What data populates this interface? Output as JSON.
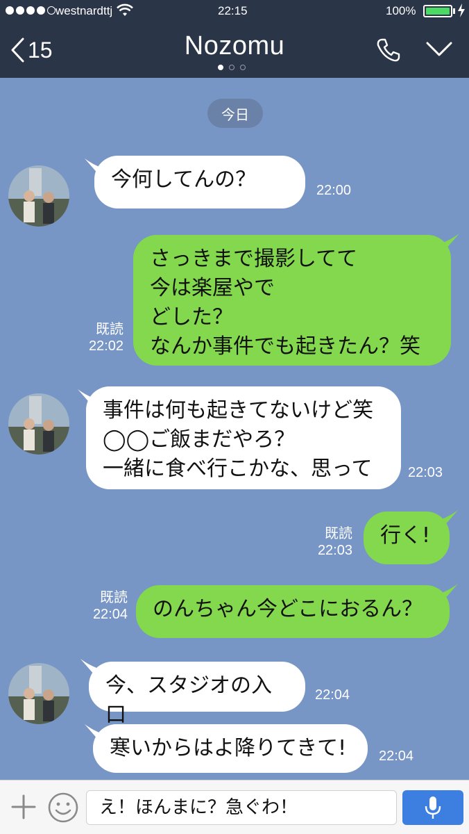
{
  "status_bar": {
    "carrier": "westnardttj",
    "time": "22:15",
    "battery": "100%",
    "battery_level": 1.0
  },
  "header": {
    "back_count": "15",
    "title": "Nozomu",
    "page_dots": 3,
    "page_current": 1
  },
  "chat": {
    "date_label": "今日",
    "messages": [
      {
        "dir": "in",
        "text": "今何してんの？",
        "time": "22:00"
      },
      {
        "dir": "out",
        "text": "さっきまで撮影してて\n今は楽屋やで\nどした？\nなんか事件でも起きたん？笑",
        "read": "既読",
        "time": "22:02"
      },
      {
        "dir": "in",
        "text": "事件は何も起きてないけど笑\n◯◯ご飯まだやろ？\n一緒に食べ行こかな、思って",
        "time": "22:03"
      },
      {
        "dir": "out",
        "text": "行く!",
        "read": "既読",
        "time": "22:03"
      },
      {
        "dir": "out",
        "text": "のんちゃん今どこにおるん？",
        "read": "既読",
        "time": "22:04"
      },
      {
        "dir": "in",
        "text": "今、スタジオの入口",
        "time": "22:04"
      },
      {
        "dir": "in",
        "text": "寒いからはよ降りてきて!",
        "time": "22:04"
      }
    ]
  },
  "input": {
    "value": "え！ほんまに？急ぐわ！"
  },
  "colors": {
    "header_bg": "#2b3548",
    "chat_bg": "#7896c5",
    "outgoing_bubble": "#84d84e",
    "incoming_bubble": "#ffffff",
    "mic_button": "#3c7fe0"
  }
}
